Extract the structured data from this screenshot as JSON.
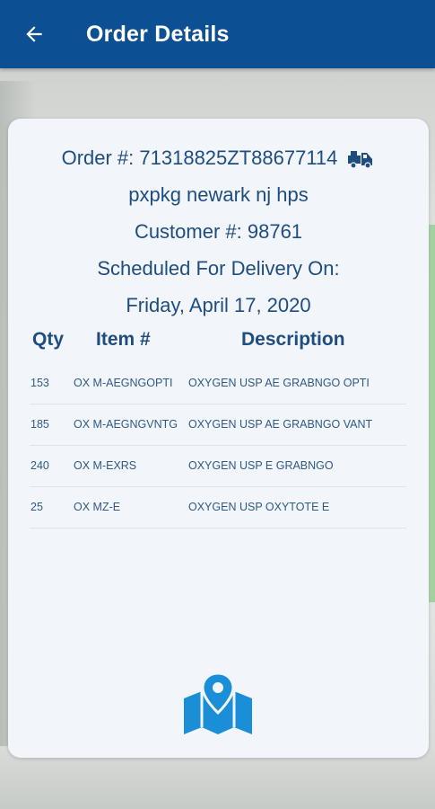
{
  "header": {
    "title": "Order Details"
  },
  "order": {
    "number_text": "Order #: 71318825ZT88677114",
    "location": "pxpkg newark nj hps",
    "customer_text": "Customer #: 98761",
    "scheduled_label": "Scheduled For Delivery On:",
    "delivery_date": "Friday, April 17, 2020"
  },
  "table": {
    "headers": {
      "qty": "Qty",
      "item": "Item #",
      "description": "Description"
    },
    "rows": [
      {
        "qty": "153",
        "item": "OX M-AEGNGOPTI",
        "description": "OXYGEN USP AE GRABNGO OPTI"
      },
      {
        "qty": "185",
        "item": "OX M-AEGNGVNTG",
        "description": "OXYGEN USP AE GRABNGO VANT"
      },
      {
        "qty": "240",
        "item": "OX M-EXRS",
        "description": "OXYGEN USP E GRABNGO"
      },
      {
        "qty": "25",
        "item": "OX MZ-E",
        "description": "OXYGEN USP OXYTOTE E"
      }
    ]
  },
  "icons": {
    "back": "back-arrow-icon",
    "truck": "delivery-truck-icon",
    "map": "map-pin-icon"
  },
  "colors": {
    "primary": "#0d4f93",
    "text": "#1f4d80",
    "map_accent": "#1a8fd8",
    "card_bg": "#f2f5f9"
  }
}
